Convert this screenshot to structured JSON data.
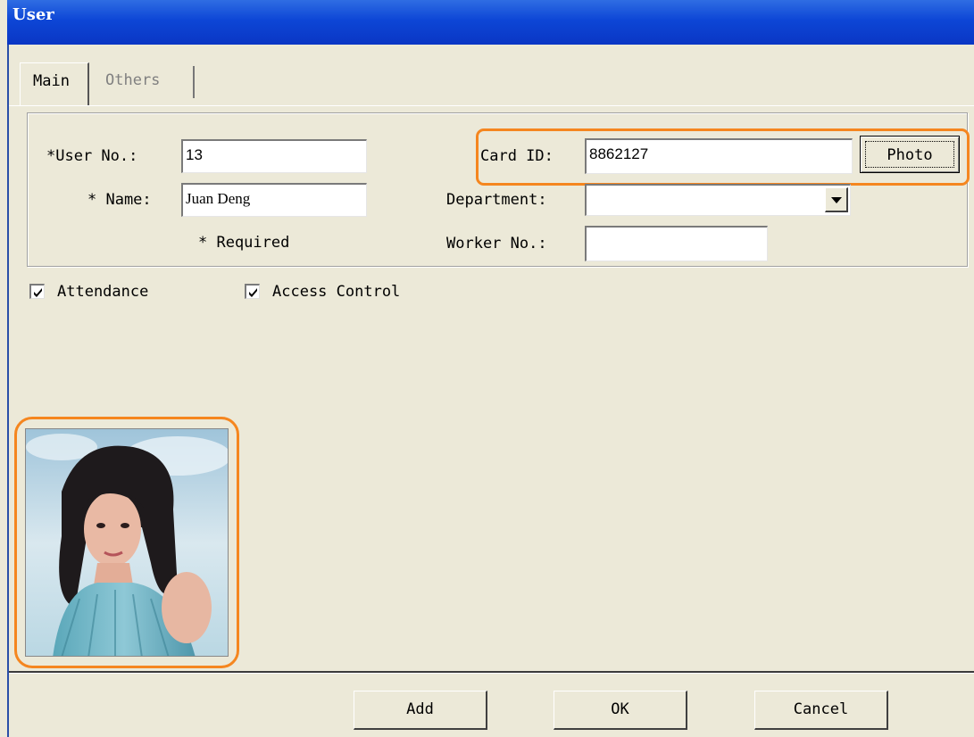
{
  "window": {
    "title": "User"
  },
  "tabs": [
    {
      "label": "Main",
      "active": true
    },
    {
      "label": "Others",
      "active": false
    }
  ],
  "form": {
    "user_no_label": "*User No.:",
    "user_no_value": "13",
    "name_label": "* Name:",
    "name_value": "Juan Deng",
    "required_note": "*  Required",
    "card_id_label": "Card ID:",
    "card_id_value": "8862127",
    "photo_button": "Photo",
    "department_label": "Department:",
    "department_value": "",
    "worker_no_label": "Worker No.:",
    "worker_no_value": ""
  },
  "checkboxes": [
    {
      "label": "Attendance",
      "checked": true
    },
    {
      "label": "Access Control",
      "checked": true
    }
  ],
  "buttons": {
    "add": "Add",
    "ok": "OK",
    "cancel": "Cancel"
  },
  "colors": {
    "title_bar": "#0d46d6",
    "highlight": "#f5861f",
    "background": "#ece9d8"
  }
}
